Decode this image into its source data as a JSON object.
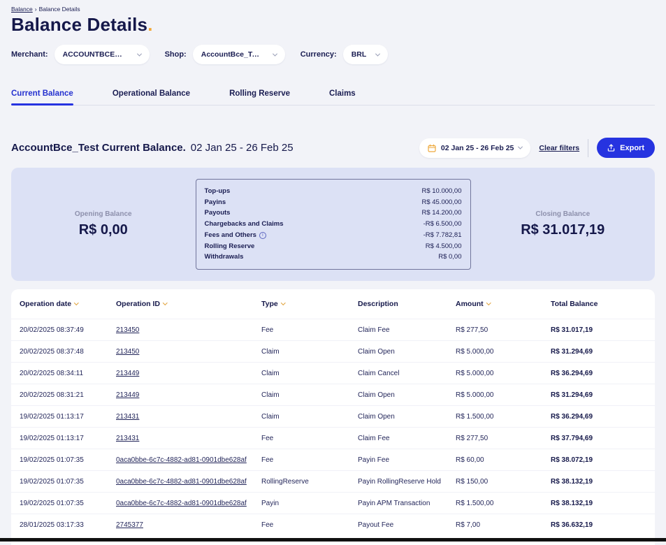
{
  "colors": {
    "accent_blue": "#2633e0",
    "accent_yellow": "#f2a735",
    "navy": "#15184a",
    "summary_bg": "#dce1f5"
  },
  "breadcrumb": {
    "parent": "Balance",
    "separator": "›",
    "current": "Balance Details"
  },
  "page": {
    "title": "Balance Details",
    "title_dot": "."
  },
  "filters": {
    "merchant_label": "Merchant:",
    "merchant_value": "ACCOUNTBCE_Test",
    "shop_label": "Shop:",
    "shop_value": "AccountBce_Test",
    "currency_label": "Currency:",
    "currency_value": "BRL"
  },
  "tabs": [
    {
      "label": "Current Balance",
      "active": true
    },
    {
      "label": "Operational Balance",
      "active": false
    },
    {
      "label": "Rolling Reserve",
      "active": false
    },
    {
      "label": "Claims",
      "active": false
    }
  ],
  "section": {
    "heading_bold": "AccountBce_Test Current Balance.",
    "heading_range": "02 Jan 25 - 26 Feb 25",
    "date_picker": "02 Jan 25 - 26 Feb 25",
    "clear_filters": "Clear filters",
    "export_label": "Export"
  },
  "summary": {
    "opening_label": "Opening Balance",
    "opening_value": "R$ 0,00",
    "closing_label": "Closing Balance",
    "closing_value": "R$ 31.017,19",
    "lines": [
      {
        "label": "Top-ups",
        "value": "R$ 10.000,00",
        "info": false
      },
      {
        "label": "Payins",
        "value": "R$ 45.000,00",
        "info": false
      },
      {
        "label": "Payouts",
        "value": "R$ 14.200,00",
        "info": false
      },
      {
        "label": "Chargebacks and Claims",
        "value": "-R$ 6.500,00",
        "info": false
      },
      {
        "label": "Fees and Others",
        "value": "-R$ 7.782,81",
        "info": true
      },
      {
        "label": "Rolling Reserve",
        "value": "R$ 4.500,00",
        "info": false
      },
      {
        "label": "Withdrawals",
        "value": "R$ 0,00",
        "info": false
      }
    ]
  },
  "table": {
    "columns": [
      {
        "label": "Operation date",
        "sortable": true
      },
      {
        "label": "Operation ID",
        "sortable": true
      },
      {
        "label": "Type",
        "sortable": true
      },
      {
        "label": "Description",
        "sortable": false
      },
      {
        "label": "Amount",
        "sortable": true
      },
      {
        "label": "Total Balance",
        "sortable": false
      }
    ],
    "rows": [
      {
        "date": "20/02/2025 08:37:49",
        "id": "213450",
        "type": "Fee",
        "description": "Claim Fee",
        "amount": "R$ 277,50",
        "total": "R$ 31.017,19"
      },
      {
        "date": "20/02/2025 08:37:48",
        "id": "213450",
        "type": "Claim",
        "description": "Claim Open",
        "amount": "R$ 5.000,00",
        "total": "R$ 31.294,69"
      },
      {
        "date": "20/02/2025 08:34:11",
        "id": "213449",
        "type": "Claim",
        "description": "Claim Cancel",
        "amount": "R$ 5.000,00",
        "total": "R$ 36.294,69"
      },
      {
        "date": "20/02/2025 08:31:21",
        "id": "213449",
        "type": "Claim",
        "description": "Claim Open",
        "amount": "R$ 5.000,00",
        "total": "R$ 31.294,69"
      },
      {
        "date": "19/02/2025 01:13:17",
        "id": "213431",
        "type": "Claim",
        "description": "Claim Open",
        "amount": "R$ 1.500,00",
        "total": "R$ 36.294,69"
      },
      {
        "date": "19/02/2025 01:13:17",
        "id": "213431",
        "type": "Fee",
        "description": "Claim Fee",
        "amount": "R$ 277,50",
        "total": "R$ 37.794,69"
      },
      {
        "date": "19/02/2025 01:07:35",
        "id": "0aca0bbe-6c7c-4882-ad81-0901dbe628af",
        "type": "Fee",
        "description": "Payin Fee",
        "amount": "R$ 60,00",
        "total": "R$ 38.072,19"
      },
      {
        "date": "19/02/2025 01:07:35",
        "id": "0aca0bbe-6c7c-4882-ad81-0901dbe628af",
        "type": "RollingReserve",
        "description": "Payin RollingReserve Hold",
        "amount": "R$ 150,00",
        "total": "R$ 38.132,19"
      },
      {
        "date": "19/02/2025 01:07:35",
        "id": "0aca0bbe-6c7c-4882-ad81-0901dbe628af",
        "type": "Payin",
        "description": "Payin APM Transaction",
        "amount": "R$ 1.500,00",
        "total": "R$ 38.132,19"
      },
      {
        "date": "28/01/2025 03:17:33",
        "id": "2745377",
        "type": "Fee",
        "description": "Payout Fee",
        "amount": "R$ 7,00",
        "total": "R$ 36.632,19"
      }
    ]
  }
}
